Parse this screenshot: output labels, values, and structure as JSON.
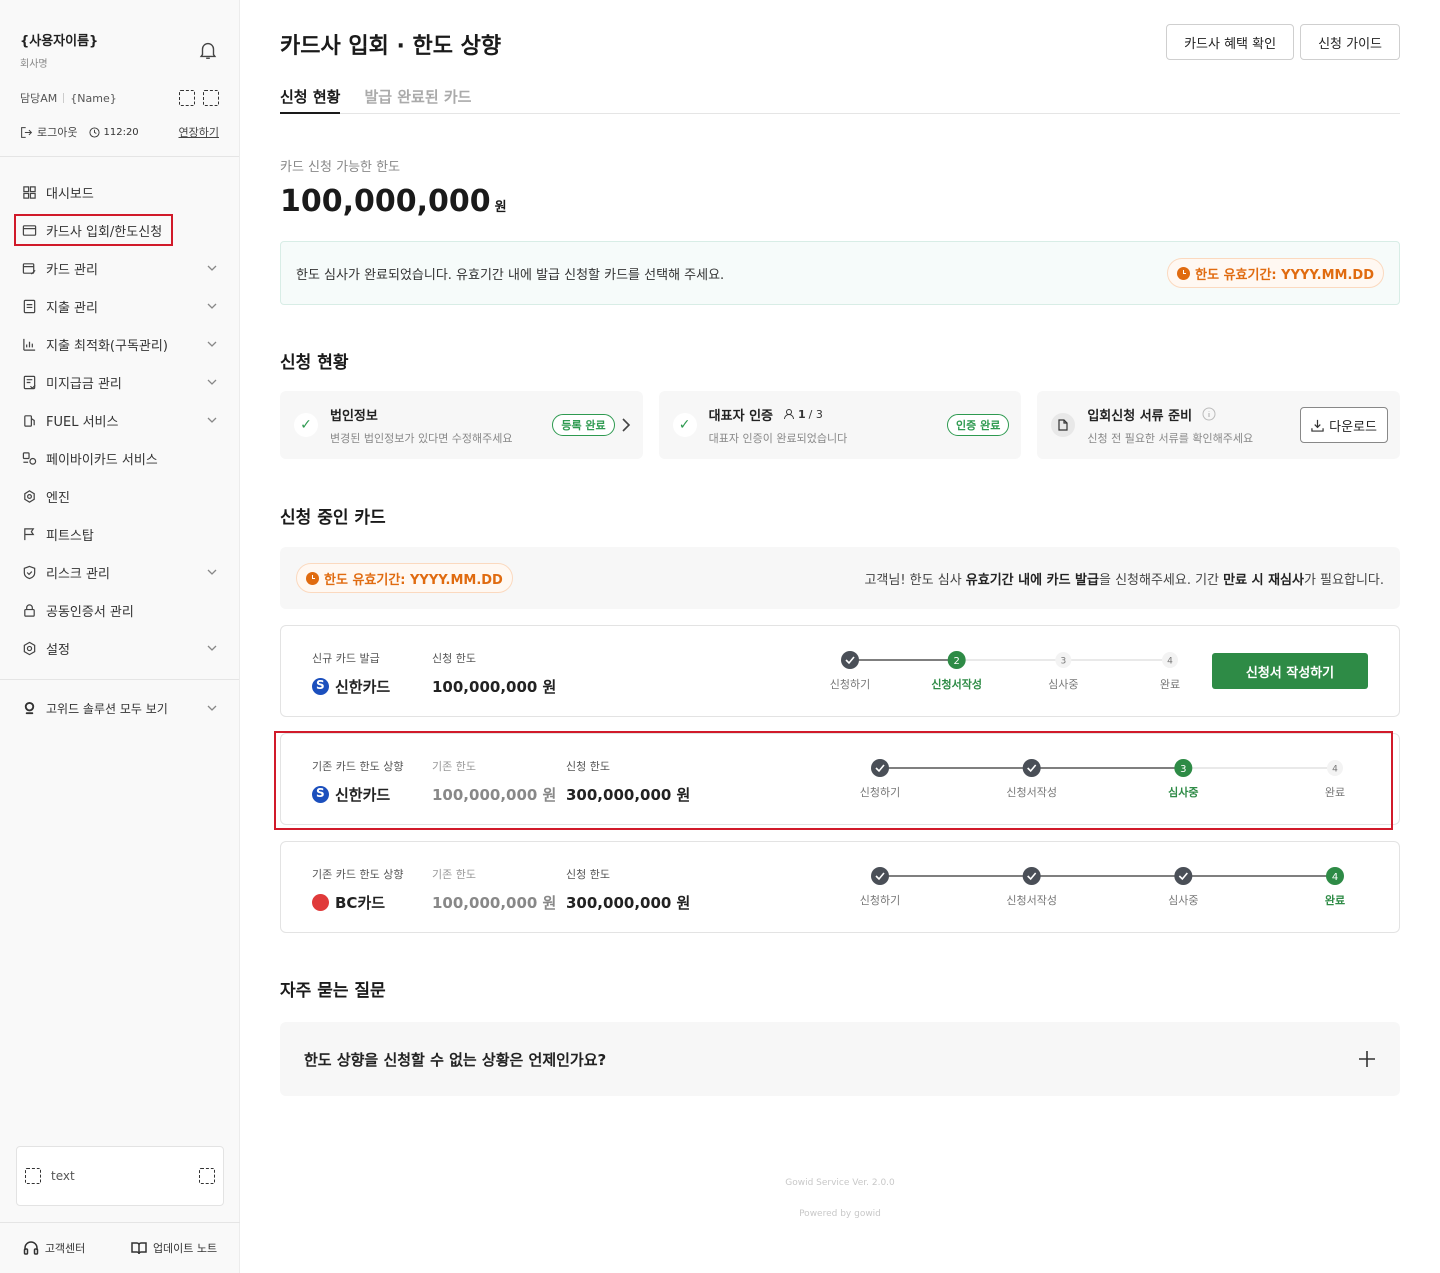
{
  "sidebar": {
    "user_name": "{사용자이름}",
    "company": "회사명",
    "am_label": "담당AM",
    "am_name": "{Name}",
    "logout": "로그아웃",
    "timer": "112:20",
    "extend": "연장하기",
    "items": [
      {
        "label": "대시보드",
        "icon": "grid-icon",
        "chevron": false
      },
      {
        "label": "카드사 입회/한도신청",
        "icon": "card-icon",
        "chevron": false,
        "active": true
      },
      {
        "label": "카드 관리",
        "icon": "card-edit-icon",
        "chevron": true
      },
      {
        "label": "지출 관리",
        "icon": "receipt-icon",
        "chevron": true
      },
      {
        "label": "지출 최적화(구독관리)",
        "icon": "chart-icon",
        "chevron": true
      },
      {
        "label": "미지급금 관리",
        "icon": "invoice-icon",
        "chevron": true
      },
      {
        "label": "FUEL 서비스",
        "icon": "fuel-icon",
        "chevron": true
      },
      {
        "label": "페이바이카드 서비스",
        "icon": "pay-icon",
        "chevron": false
      },
      {
        "label": "엔진",
        "icon": "engine-icon",
        "chevron": false
      },
      {
        "label": "피트스탑",
        "icon": "flag-icon",
        "chevron": false
      },
      {
        "label": "리스크 관리",
        "icon": "shield-icon",
        "chevron": true
      },
      {
        "label": "공동인증서 관리",
        "icon": "lock-icon",
        "chevron": false
      },
      {
        "label": "설정",
        "icon": "gear-icon",
        "chevron": true
      }
    ],
    "solutions": "고위드 솔루션 모두 보기",
    "text_box": "text",
    "customer_center": "고객센터",
    "update_notes": "업데이트 노트"
  },
  "header": {
    "title": "카드사 입회 · 한도 상향",
    "benefit_btn": "카드사 혜택 확인",
    "guide_btn": "신청 가이드"
  },
  "tabs": [
    {
      "label": "신청 현황",
      "active": true
    },
    {
      "label": "발급 완료된 카드",
      "active": false
    }
  ],
  "limit": {
    "label": "카드 신청 가능한 한도",
    "amount": "100,000,000",
    "unit": "원"
  },
  "notice": {
    "text": "한도 심사가 완료되었습니다. 유효기간 내에 발급 신청할 카드를 선택해 주세요.",
    "expiry": "한도 유효기간: YYYY.MM.DD"
  },
  "status": {
    "title": "신청 현황",
    "cards": [
      {
        "title": "법인정보",
        "desc": "변경된 법인정보가 있다면 수정해주세요",
        "badge": "등록 완료"
      },
      {
        "title": "대표자 인증",
        "count_cur": "1",
        "count_total": "/ 3",
        "desc": "대표자 인증이 완료되었습니다",
        "badge": "인증 완료"
      },
      {
        "title": "입회신청 서류 준비",
        "desc": "신청 전 필요한 서류를 확인해주세요",
        "button": "다운로드"
      }
    ]
  },
  "pending": {
    "title": "신청 중인 카드",
    "expiry": "한도 유효기간: YYYY.MM.DD",
    "msg_a": "고객님! 한도 심사 ",
    "msg_b": "유효기간 내에 카드 발급",
    "msg_c": "을 신청해주세요. 기간 ",
    "msg_d": "만료 시 재심사",
    "msg_e": "가 필요합니다.",
    "cards": [
      {
        "type": "신규 카드 발급",
        "brand": "신한카드",
        "limit_label": "신청 한도",
        "limit": "100,000,000 원",
        "current_step": 2,
        "button": "신청서 작성하기"
      },
      {
        "type": "기존 카드 한도 상향",
        "brand": "신한카드",
        "old_label": "기존 한도",
        "old_limit": "100,000,000 원",
        "limit_label": "신청 한도",
        "limit": "300,000,000 원",
        "current_step": 3
      },
      {
        "type": "기존 카드 한도 상향",
        "brand": "BC카드",
        "old_label": "기존 한도",
        "old_limit": "100,000,000 원",
        "limit_label": "신청 한도",
        "limit": "300,000,000 원",
        "current_step": 4
      }
    ],
    "steps": [
      "신청하기",
      "신청서작성",
      "심사중",
      "완료"
    ]
  },
  "faq": {
    "title": "자주 묻는 질문",
    "question": "한도 상향을 신청할 수 없는 상황은 언제인가요?"
  },
  "footer": {
    "version": "Gowid Service Ver. 2.0.0",
    "powered": "Powered by gowid"
  },
  "colors": {
    "accent_green": "#2e8b46",
    "orange": "#e06b10",
    "highlight_red": "#d11a2a"
  }
}
